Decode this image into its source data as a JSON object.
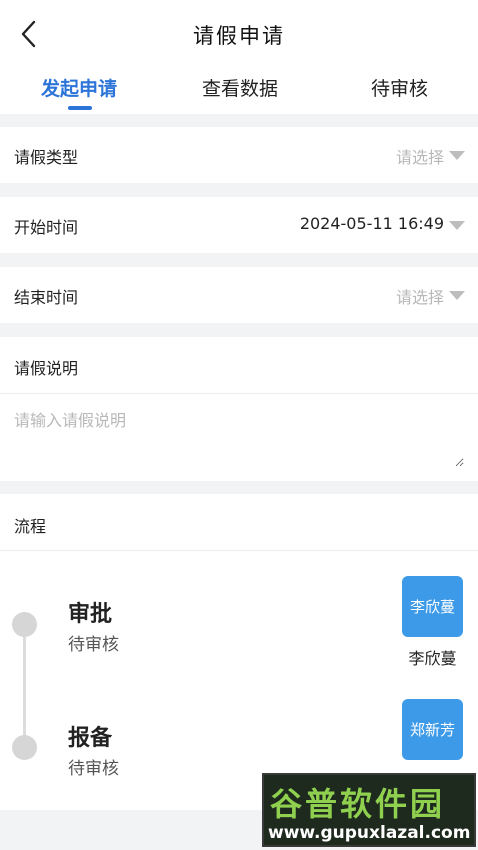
{
  "header": {
    "title": "请假申请"
  },
  "tabs": [
    {
      "label": "发起申请",
      "active": true
    },
    {
      "label": "查看数据",
      "active": false
    },
    {
      "label": "待审核",
      "active": false
    }
  ],
  "form": {
    "leave_type": {
      "label": "请假类型",
      "value": "",
      "placeholder": "请选择"
    },
    "start_time": {
      "label": "开始时间",
      "value": "2024-05-11 16:49"
    },
    "end_time": {
      "label": "结束时间",
      "value": "",
      "placeholder": "请选择"
    },
    "description": {
      "label": "请假说明",
      "value": "",
      "placeholder": "请输入请假说明"
    }
  },
  "flow": {
    "label": "流程",
    "steps": [
      {
        "title": "审批",
        "status": "待审核",
        "person_tile": "李欣蔓",
        "person_name": "李欣蔓"
      },
      {
        "title": "报备",
        "status": "待审核",
        "person_tile": "郑新芳",
        "person_name": "郑新芳"
      }
    ]
  },
  "watermark": {
    "logo_text": "谷普软件园",
    "url": "www.gupuxlazal.com"
  },
  "colors": {
    "accent": "#2c74d8",
    "tile": "#3d9ae8",
    "background": "#f2f3f5",
    "placeholder": "#b8b8b8"
  }
}
